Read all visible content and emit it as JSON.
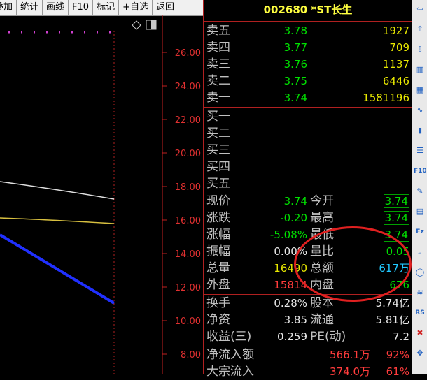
{
  "toolbar": {
    "buttons": [
      "叠加",
      "统计",
      "画线",
      "F10",
      "标记",
      "+自选",
      "返回"
    ]
  },
  "chart": {
    "y_ticks": [
      "26.00",
      "24.00",
      "22.00",
      "20.00",
      "18.00",
      "16.00",
      "14.00",
      "12.00",
      "10.00",
      "8.00"
    ],
    "colors": {
      "line_white": "#e0e0e0",
      "line_yellow": "#d8c040",
      "line_blue": "#2030ff",
      "axis": "#c02020",
      "dots": "#d040d0"
    }
  },
  "quote": {
    "title": "002680 *ST长生",
    "sell": [
      {
        "label": "卖五",
        "price": "3.78",
        "vol": "1927"
      },
      {
        "label": "卖四",
        "price": "3.77",
        "vol": "709"
      },
      {
        "label": "卖三",
        "price": "3.76",
        "vol": "1137"
      },
      {
        "label": "卖二",
        "price": "3.75",
        "vol": "6446"
      },
      {
        "label": "卖一",
        "price": "3.74",
        "vol": "1581196"
      }
    ],
    "buy": [
      {
        "label": "买一"
      },
      {
        "label": "买二"
      },
      {
        "label": "买三"
      },
      {
        "label": "买四"
      },
      {
        "label": "买五"
      }
    ],
    "stats": [
      {
        "l1": "现价",
        "v1": "3.74",
        "l2": "今开",
        "v2": "3.74"
      },
      {
        "l1": "涨跌",
        "v1": "-0.20",
        "l2": "最高",
        "v2": "3.74"
      },
      {
        "l1": "涨幅",
        "v1": "-5.08%",
        "l2": "最低",
        "v2": "3.74"
      },
      {
        "l1": "振幅",
        "v1": "0.00%",
        "l2": "量比",
        "v2": "0.05"
      },
      {
        "l1": "总量",
        "v1": "16490",
        "l2": "总额",
        "v2": "617万"
      },
      {
        "l1": "外盘",
        "v1": "15814",
        "l2": "内盘",
        "v2": "676"
      }
    ],
    "fund": [
      {
        "l1": "换手",
        "v1": "0.28%",
        "l2": "股本",
        "v2": "5.74亿"
      },
      {
        "l1": "净资",
        "v1": "3.85",
        "l2": "流通",
        "v2": "5.81亿"
      },
      {
        "l1": "收益(三)",
        "v1": "0.259",
        "l2": "PE(动)",
        "v2": "7.2"
      }
    ],
    "flow": [
      {
        "label": "净流入额",
        "value": "566.1万",
        "pct": "92%"
      },
      {
        "label": "大宗流入",
        "value": "374.0万",
        "pct": "61%"
      }
    ]
  },
  "right_toolbar": {
    "icons": [
      "back-icon",
      "up-icon",
      "down-icon",
      "chart-icon",
      "table-icon",
      "line-icon",
      "candle-icon",
      "list-icon",
      "f10-icon",
      "note-icon",
      "grid-icon",
      "fz-icon",
      "zoom-icon",
      "circle-icon",
      "wave-icon",
      "rs-icon",
      "stop-icon",
      "move-icon"
    ],
    "texts": [
      "",
      "",
      "",
      "",
      "",
      "",
      "",
      "",
      "F10",
      "",
      "",
      "Fz",
      "",
      "",
      "",
      "RS",
      "",
      ""
    ]
  }
}
